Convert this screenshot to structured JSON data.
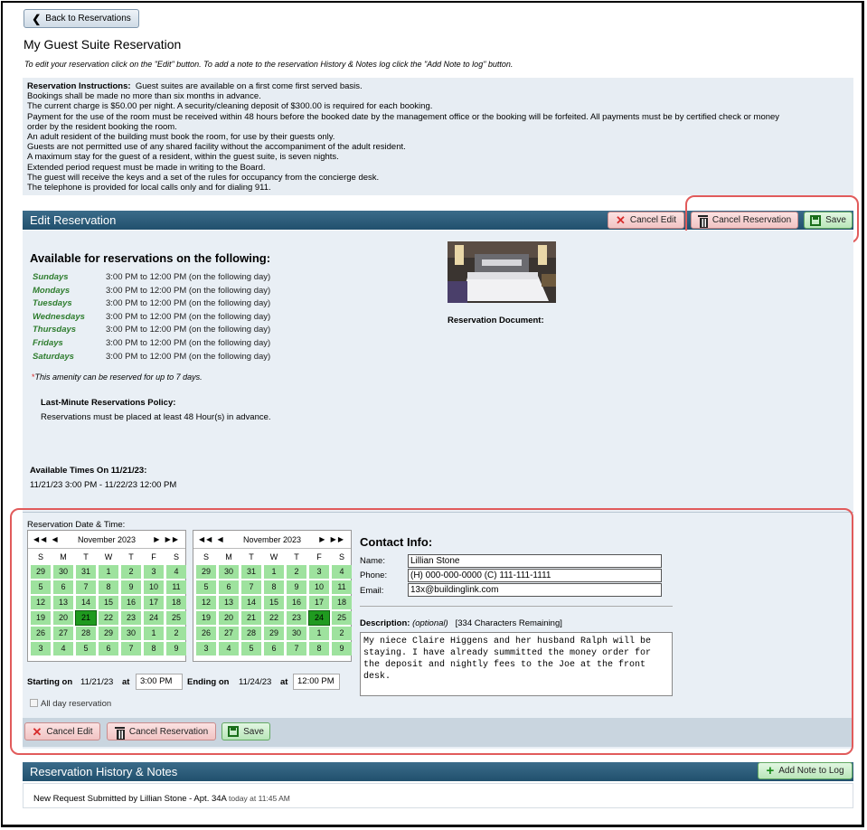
{
  "back_label": "Back to Reservations",
  "page_title": "My Guest Suite Reservation",
  "subtitle": "To edit your reservation click on the \"Edit\" button. To add a note to the reservation History & Notes log click the \"Add Note to log\" button.",
  "instructions": {
    "heading": "Reservation Instructions:",
    "lines": [
      "Guest suites are available on a first come first served basis.",
      "Bookings shall be made no more than six months in advance.",
      "The current charge is $50.00 per night. A security/cleaning deposit of $300.00 is required for each booking.",
      "Payment for the use of the room must be received within 48 hours before the booked date by the management office or the booking will be forfeited. All payments must be by certified check or money",
      "order by the resident booking the room.",
      "An adult resident of the building must book the room, for use by their guests only.",
      "Guests are not permitted use of any shared facility without the accompaniment of the adult resident.",
      "A maximum stay for the guest of a resident, within the guest suite, is seven nights.",
      "Extended period request must be made in writing to the Board.",
      "The guest will receive the keys and a set of the rules for occupancy from the concierge desk.",
      "The telephone is provided for local calls only and for dialing 911."
    ]
  },
  "edit_section": {
    "title": "Edit Reservation",
    "cancel_edit": "Cancel Edit",
    "cancel_reservation": "Cancel Reservation",
    "save": "Save"
  },
  "availability": {
    "title": "Available for reservations on the following:",
    "days": [
      {
        "day": "Sundays",
        "time": "3:00 PM to 12:00 PM (on the following day)"
      },
      {
        "day": "Mondays",
        "time": "3:00 PM to 12:00 PM (on the following day)"
      },
      {
        "day": "Tuesdays",
        "time": "3:00 PM to 12:00 PM (on the following day)"
      },
      {
        "day": "Wednesdays",
        "time": "3:00 PM to 12:00 PM (on the following day)"
      },
      {
        "day": "Thursdays",
        "time": "3:00 PM to 12:00 PM (on the following day)"
      },
      {
        "day": "Fridays",
        "time": "3:00 PM to 12:00 PM (on the following day)"
      },
      {
        "day": "Saturdays",
        "time": "3:00 PM to 12:00 PM (on the following day)"
      }
    ],
    "note_star": "*",
    "note": "This amenity can be reserved for up to 7 days.",
    "policy_title": "Last-Minute Reservations Policy:",
    "policy_text": "Reservations must be placed at least 48 Hour(s) in advance.",
    "available_times_title": "Available Times On 11/21/23:",
    "available_times_value": "11/21/23 3:00 PM - 11/22/23 12:00 PM",
    "document_label": "Reservation Document:"
  },
  "reservation": {
    "date_time_label": "Reservation Date & Time:",
    "calendar_month": "November 2023",
    "dow": [
      "S",
      "M",
      "T",
      "W",
      "T",
      "F",
      "S"
    ],
    "days": [
      "29",
      "30",
      "31",
      "1",
      "2",
      "3",
      "4",
      "5",
      "6",
      "7",
      "8",
      "9",
      "10",
      "11",
      "12",
      "13",
      "14",
      "15",
      "16",
      "17",
      "18",
      "19",
      "20",
      "21",
      "22",
      "23",
      "24",
      "25",
      "26",
      "27",
      "28",
      "29",
      "30",
      "1",
      "2",
      "3",
      "4",
      "5",
      "6",
      "7",
      "8",
      "9"
    ],
    "start_selected": "21",
    "end_selected": "24",
    "starting_label": "Starting on",
    "starting_date": "11/21/23",
    "at": "at",
    "starting_time": "3:00 PM",
    "ending_label": "Ending on",
    "ending_date": "11/24/23",
    "ending_time": "12:00 PM",
    "all_day": "All day reservation"
  },
  "contact": {
    "title": "Contact Info:",
    "name_label": "Name:",
    "name": "Lillian Stone",
    "phone_label": "Phone:",
    "phone": "(H) 000-000-0000 (C) 111-111-1111",
    "email_label": "Email:",
    "email": "13x@buildinglink.com",
    "description_label": "Description:",
    "optional": "(optional)",
    "remaining": "[334 Characters Remaining]",
    "description": "My niece Claire Higgens and her husband Ralph will be staying. I have already summitted the money order for the deposit and nightly fees to the Joe at the front desk."
  },
  "history": {
    "title": "Reservation History & Notes",
    "add_note": "Add Note to Log",
    "entry": "New Request Submitted by Lillian Stone - Apt. 34A",
    "entry_time": "today at 11:45 AM"
  },
  "colors": {
    "section_bar": "#2b5b79",
    "calendar_day": "#9ee29e",
    "calendar_selected": "#1f9a1f",
    "highlight_outline": "#e15b5b",
    "day_label": "#2e7d2e"
  }
}
